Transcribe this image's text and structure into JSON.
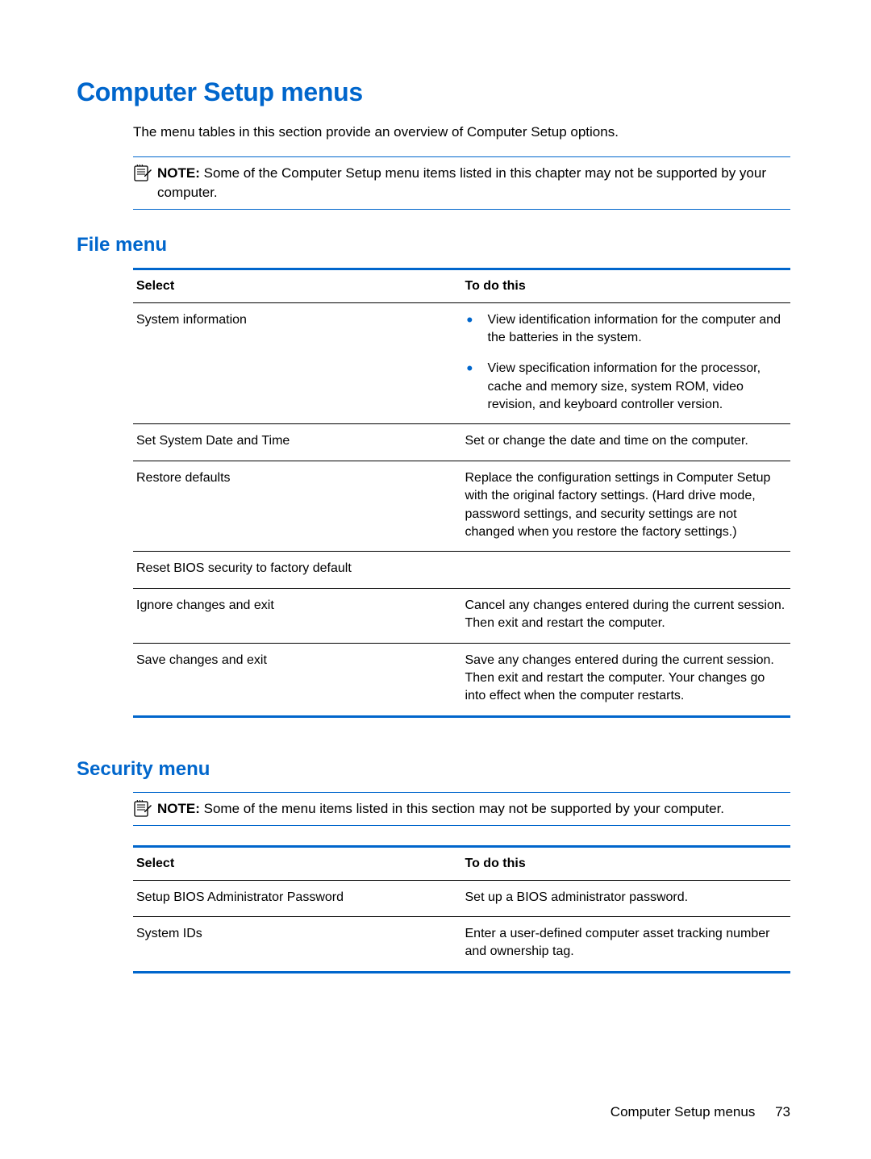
{
  "heading": "Computer Setup menus",
  "intro": "The menu tables in this section provide an overview of Computer Setup options.",
  "note1": {
    "label": "NOTE:",
    "text": "Some of the Computer Setup menu items listed in this chapter may not be supported by your computer."
  },
  "fileMenu": {
    "heading": "File menu",
    "headers": {
      "select": "Select",
      "todo": "To do this"
    },
    "rows": {
      "r0": {
        "select": "System information",
        "bullets": {
          "b0": "View identification information for the computer and the batteries in the system.",
          "b1": "View specification information for the processor, cache and memory size, system ROM, video revision, and keyboard controller version."
        }
      },
      "r1": {
        "select": "Set System Date and Time",
        "todo": "Set or change the date and time on the computer."
      },
      "r2": {
        "select": "Restore defaults",
        "todo": "Replace the configuration settings in Computer Setup with the original factory settings. (Hard drive mode, password settings, and security settings are not changed when you restore the factory settings.)"
      },
      "r3": {
        "select": "Reset BIOS security to factory default",
        "todo": ""
      },
      "r4": {
        "select": "Ignore changes and exit",
        "todo": "Cancel any changes entered during the current session. Then exit and restart the computer."
      },
      "r5": {
        "select": "Save changes and exit",
        "todo": "Save any changes entered during the current session. Then exit and restart the computer. Your changes go into effect when the computer restarts."
      }
    }
  },
  "securityMenu": {
    "heading": "Security menu",
    "note": {
      "label": "NOTE:",
      "text": "Some of the menu items listed in this section may not be supported by your computer."
    },
    "headers": {
      "select": "Select",
      "todo": "To do this"
    },
    "rows": {
      "r0": {
        "select": "Setup BIOS Administrator Password",
        "todo": "Set up a BIOS administrator password."
      },
      "r1": {
        "select": "System IDs",
        "todo": "Enter a user-defined computer asset tracking number and ownership tag."
      }
    }
  },
  "footer": {
    "title": "Computer Setup menus",
    "page": "73"
  }
}
